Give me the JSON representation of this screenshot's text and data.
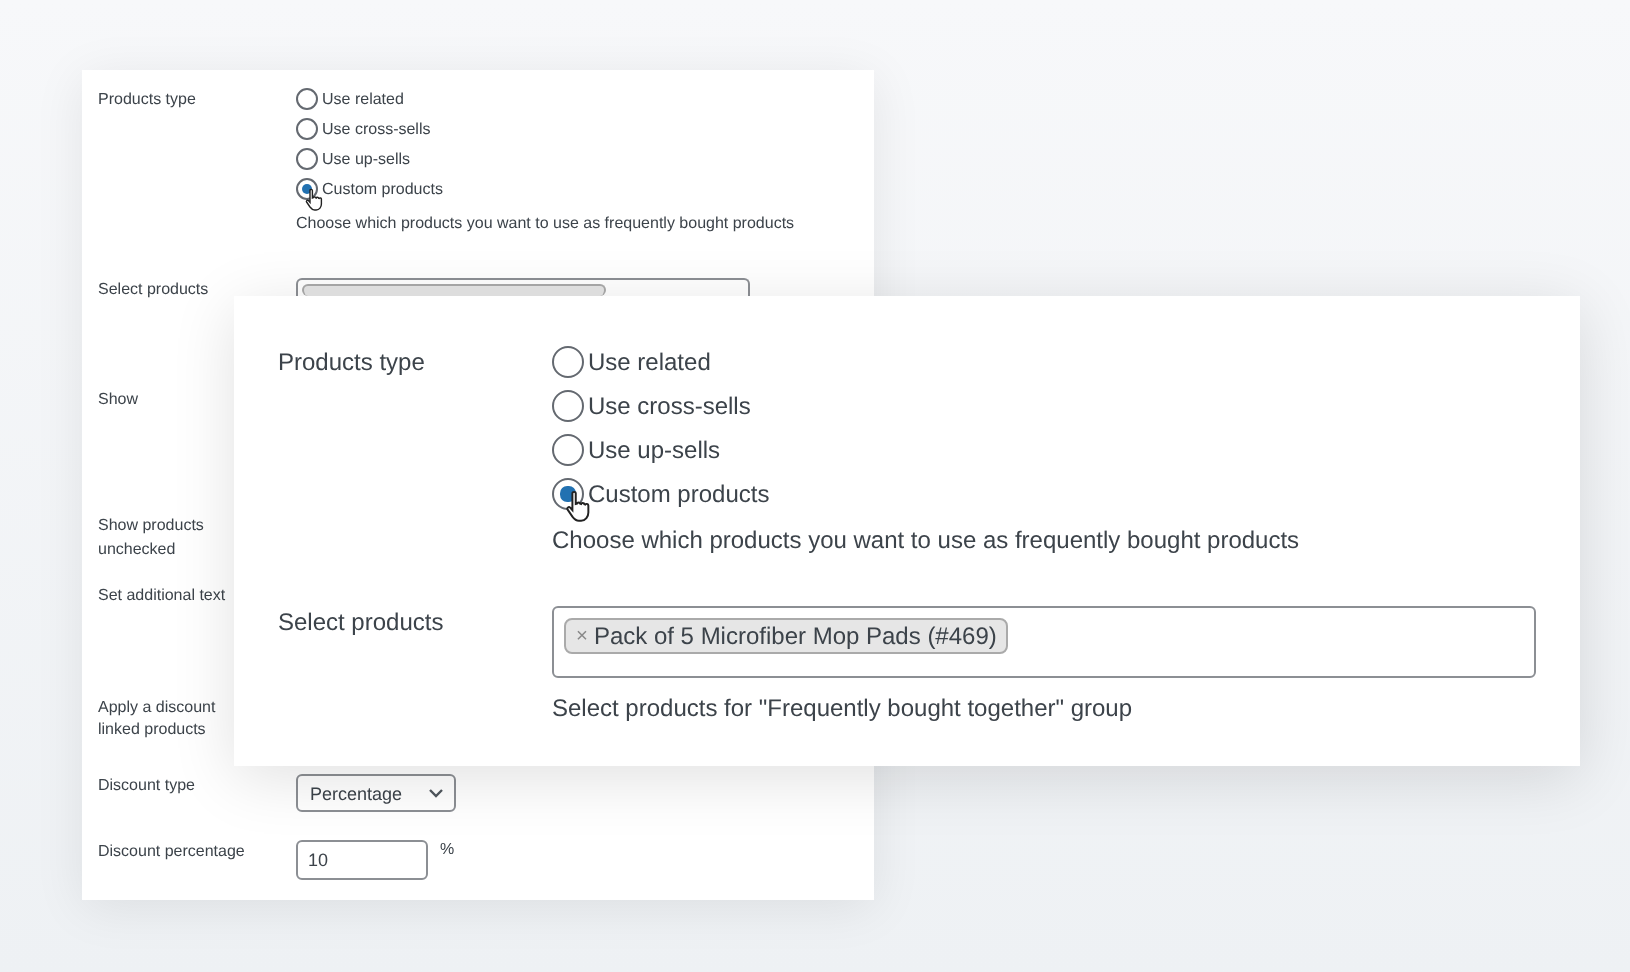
{
  "settings_panel": {
    "rows": [
      {
        "kind": "radios",
        "label": "Products type",
        "options": [
          {
            "label": "Use related",
            "selected": false
          },
          {
            "label": "Use cross-sells",
            "selected": false
          },
          {
            "label": "Use up-sells",
            "selected": false
          },
          {
            "label": "Custom products",
            "selected": true
          }
        ],
        "hint": "Choose which products you want to use as frequently bought products"
      },
      {
        "kind": "products",
        "label": "Select products"
      },
      {
        "kind": "covered",
        "label": "Show"
      },
      {
        "kind": "covered",
        "label": "Show products\nunchecked"
      },
      {
        "kind": "covered",
        "label": "Set additional text"
      },
      {
        "kind": "covered",
        "label": "Apply a discount\nlinked products"
      },
      {
        "kind": "select",
        "label": "Discount type",
        "value": "Percentage"
      },
      {
        "kind": "number",
        "label": "Discount percentage",
        "value": "10",
        "unit": "%"
      }
    ]
  },
  "zoomed_card": {
    "rows": [
      {
        "kind": "radios",
        "label": "Products type",
        "options": [
          {
            "label": "Use related",
            "selected": false
          },
          {
            "label": "Use cross-sells",
            "selected": false
          },
          {
            "label": "Use up-sells",
            "selected": false
          },
          {
            "label": "Custom products",
            "selected": true
          }
        ],
        "hint": "Choose which products you want to use as frequently bought products"
      },
      {
        "kind": "products",
        "label": "Select products",
        "tags": [
          "Pack of 5 Microfiber Mop Pads (#469)"
        ],
        "tag_remove": "×",
        "hint": "Select products for \"Frequently bought together\" group"
      }
    ]
  }
}
